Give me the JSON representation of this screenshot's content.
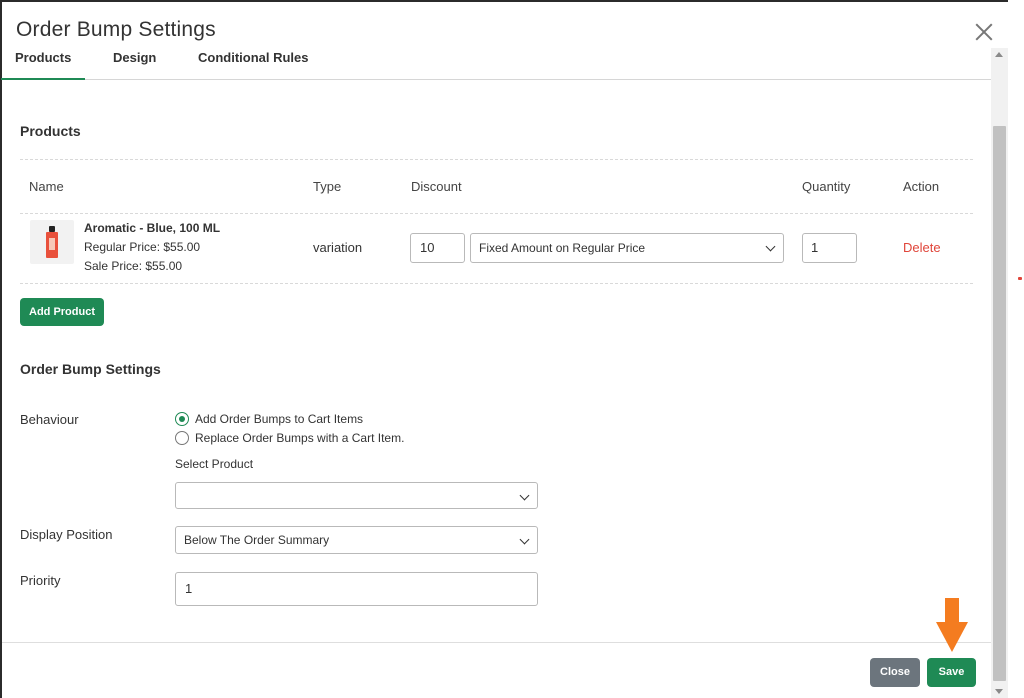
{
  "modal": {
    "title": "Order Bump Settings",
    "close_icon": "close-x-icon"
  },
  "tabs": [
    {
      "label": "Products",
      "active": true
    },
    {
      "label": "Design",
      "active": false
    },
    {
      "label": "Conditional Rules",
      "active": false
    }
  ],
  "products_section": {
    "title": "Products",
    "columns": [
      "Name",
      "Type",
      "Discount",
      "Quantity",
      "Action"
    ],
    "rows": [
      {
        "image_icon": "perfume-bottle-icon",
        "name": "Aromatic - Blue, 100 ML",
        "regular_price": "Regular Price: $55.00",
        "sale_price": "Sale Price: $55.00",
        "type": "variation",
        "discount_value": "10",
        "discount_type": "Fixed Amount on Regular Price",
        "quantity": "1",
        "action": "Delete"
      }
    ],
    "add_button": "Add Product"
  },
  "bump_settings": {
    "title": "Order Bump Settings",
    "behaviour_label": "Behaviour",
    "behaviour_options": [
      {
        "label": "Add Order Bumps to Cart Items",
        "checked": true
      },
      {
        "label": "Replace Order Bumps with a Cart Item.",
        "checked": false
      }
    ],
    "select_product_label": "Select Product",
    "select_product_value": "",
    "display_position_label": "Display Position",
    "display_position_value": "Below The Order Summary",
    "priority_label": "Priority",
    "priority_value": "1"
  },
  "footer": {
    "close_label": "Close",
    "save_label": "Save"
  },
  "colors": {
    "accent_green": "#1f8a55",
    "delete_red": "#e0453a",
    "close_gray": "#6c757d",
    "annotation_arrow": "#f47c20"
  }
}
